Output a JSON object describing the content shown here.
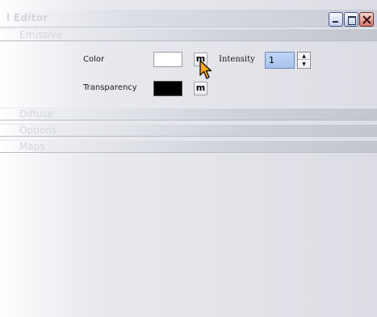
{
  "window": {
    "title": "l Editor",
    "buttons": {
      "minimize": "minimize-icon",
      "maximize": "maximize-icon",
      "close": "close-icon"
    }
  },
  "sections": {
    "emissive": "Emissive",
    "diffuse": "Diffuse",
    "options": "Options",
    "maps": "Maps"
  },
  "emissive": {
    "color_label": "Color",
    "color_value": "#ffffff",
    "color_map_button": "m",
    "transparency_label": "Transparency",
    "transparency_value": "#000000",
    "transparency_map_button": "m",
    "intensity_label": "Intensity",
    "intensity_value": "1"
  },
  "cursor": "arrow-cursor-icon"
}
